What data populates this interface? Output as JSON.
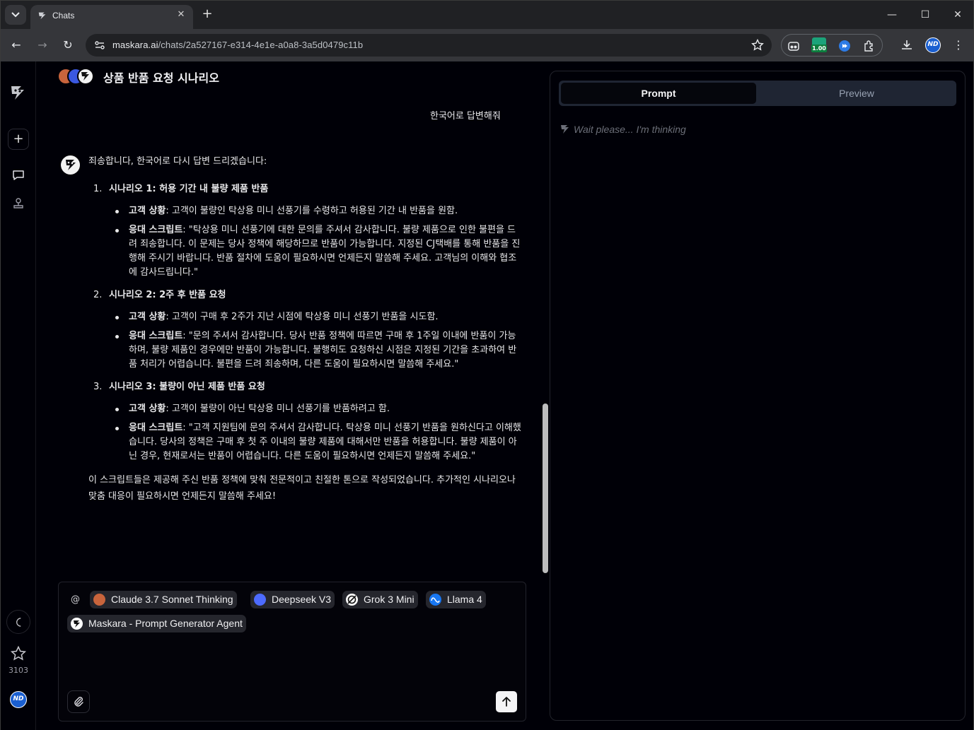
{
  "browser": {
    "tab_title": "Chats",
    "url_host": "maskara.ai",
    "url_path": "/chats/2a527167-e314-4e1e-a0a8-3a5d0479c11b",
    "extension_badge": "1.00",
    "profile_initials": "ND"
  },
  "rail": {
    "star_count": "3103",
    "avatar_initials": "ND"
  },
  "chat": {
    "title": "상품 반품 요청 시나리오",
    "user_message": "한국어로 답변해줘",
    "answer": {
      "intro": "죄송합니다, 한국어로 다시 답변 드리겠습니다:",
      "scenarios": [
        {
          "num": "1.",
          "title": "시나리오 1: 허용 기간 내 불량 제품 반품",
          "situation_label": "고객 상황",
          "situation": ": 고객이 불량인 탁상용 미니 선풍기를 수령하고 허용된 기간 내 반품을 원함.",
          "script_label": "응대 스크립트",
          "script": ": \"탁상용 미니 선풍기에 대한 문의를 주셔서 감사합니다. 불량 제품으로 인한 불편을 드려 죄송합니다. 이 문제는 당사 정책에 해당하므로 반품이 가능합니다. 지정된 CJ택배를 통해 반품을 진행해 주시기 바랍니다. 반품 절차에 도움이 필요하시면 언제든지 말씀해 주세요. 고객님의 이해와 협조에 감사드립니다.\""
        },
        {
          "num": "2.",
          "title": "시나리오 2: 2주 후 반품 요청",
          "situation_label": "고객 상황",
          "situation": ": 고객이 구매 후 2주가 지난 시점에 탁상용 미니 선풍기 반품을 시도함.",
          "script_label": "응대 스크립트",
          "script": ": \"문의 주셔서 감사합니다. 당사 반품 정책에 따르면 구매 후 1주일 이내에 반품이 가능하며, 불량 제품인 경우에만 반품이 가능합니다. 불행히도 요청하신 시점은 지정된 기간을 초과하여 반품 처리가 어렵습니다. 불편을 드려 죄송하며, 다른 도움이 필요하시면 말씀해 주세요.\""
        },
        {
          "num": "3.",
          "title": "시나리오 3: 불량이 아닌 제품 반품 요청",
          "situation_label": "고객 상황",
          "situation": ": 고객이 불량이 아닌 탁상용 미니 선풍기를 반품하려고 함.",
          "script_label": "응대 스크립트",
          "script": ": \"고객 지원팀에 문의 주셔서 감사합니다. 탁상용 미니 선풍기 반품을 원하신다고 이해했습니다. 당사의 정책은 구매 후 첫 주 이내의 불량 제품에 대해서만 반품을 허용합니다. 불량 제품이 아닌 경우, 현재로서는 반품이 어렵습니다. 다른 도움이 필요하시면 언제든지 말씀해 주세요.\""
        }
      ],
      "outro": "이 스크립트들은 제공해 주신 반품 정책에 맞춰 전문적이고 친절한 톤으로 작성되었습니다. 추가적인 시나리오나 맞춤 대응이 필요하시면 언제든지 말씀해 주세요!"
    }
  },
  "composer": {
    "at_symbol": "@",
    "models": [
      {
        "label": "Claude 3.7 Sonnet Thinking",
        "icon": "claude-icon",
        "color": "#c8643c"
      },
      {
        "label": "Deepseek V3",
        "icon": "deepseek-icon",
        "color": "#4d6bfe"
      },
      {
        "label": "Grok 3 Mini",
        "icon": "grok-icon",
        "color": "#ffffff"
      },
      {
        "label": "Llama 4",
        "icon": "meta-icon",
        "color": "#1877f2"
      },
      {
        "label": "Maskara - Prompt Generator Agent",
        "icon": "maskara-icon",
        "color": "#ffffff"
      }
    ]
  },
  "panel": {
    "tabs": [
      "Prompt",
      "Preview"
    ],
    "active_tab": "Prompt",
    "thinking_text": "Wait please... I'm thinking"
  }
}
